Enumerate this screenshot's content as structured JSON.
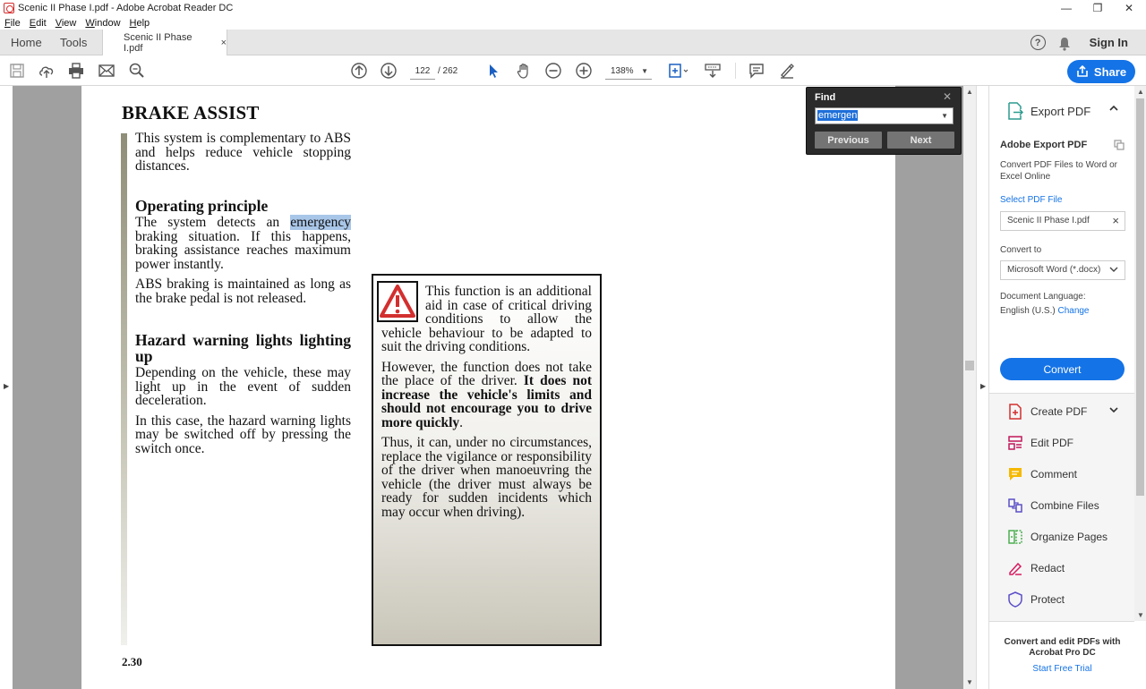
{
  "window": {
    "title": "Scenic II Phase I.pdf - Adobe Acrobat Reader DC",
    "controls": {
      "minimize": "—",
      "restore": "❐",
      "close": "✕"
    }
  },
  "menu": [
    "File",
    "Edit",
    "View",
    "Window",
    "Help"
  ],
  "tabs": {
    "home": "Home",
    "tools": "Tools",
    "document": "Scenic II Phase I.pdf",
    "close": "×",
    "sign_in": "Sign In",
    "help": "?"
  },
  "toolbar": {
    "page_current": "122",
    "page_total": "/ 262",
    "zoom": "138%",
    "share": "Share",
    "icons": [
      "save-icon",
      "upload-icon",
      "print-icon",
      "email-icon",
      "search-icon",
      "page-up-icon",
      "page-down-icon",
      "select-cursor-icon",
      "hand-icon",
      "zoom-out-icon",
      "zoom-in-icon",
      "page-fit-icon",
      "scroll-mode-icon",
      "comment-icon",
      "highlight-pen-icon"
    ]
  },
  "find": {
    "label": "Find",
    "close": "✕",
    "query": "emergen",
    "previous": "Previous",
    "next": "Next"
  },
  "document": {
    "title": "BRAKE ASSIST",
    "intro": "This system is complementary to ABS and helps reduce vehicle stopping distances.",
    "heading_operating": "Operating principle",
    "op_p1_before": "The system detects an ",
    "op_p1_highlight": "emergency",
    "op_p1_after": " braking situation. If this happens, braking assistance reaches maximum power instantly.",
    "op_p2": "ABS braking is maintained as long as the brake pedal is not released.",
    "heading_hazard": "Hazard warning lights lighting up",
    "hazard_p1": "Depending on the vehicle, these may light up in the event of sudden deceleration.",
    "hazard_p2": "In this case, the hazard warning lights may be switched off by pressing the switch once.",
    "warn_p1": "This function is an additional aid in case of critical driving conditions to allow the vehicle behaviour to be adapted to suit the driving conditions.",
    "warn_p2_normal": "However, the function does not take the place of the driver. ",
    "warn_p2_bold": "It does not increase the vehicle's limits and should not encourage you to drive more quickly",
    "warn_p2_end": ".",
    "warn_p3": "Thus, it can, under no circumstances, replace the vigilance or responsibility of the driver when manoeuvring the vehicle (the driver must always be ready for sudden incidents which may occur when driving).",
    "page_label": "2.30"
  },
  "right_panel": {
    "export_title": "Export PDF",
    "card_title": "Adobe Export PDF",
    "card_desc": "Convert PDF Files to Word or Excel Online",
    "select_file": "Select PDF File",
    "file_name": "Scenic II Phase I.pdf",
    "convert_to": "Convert to",
    "format": "Microsoft Word (*.docx)",
    "doc_language": "Document Language:",
    "language": "English (U.S.)",
    "change": "Change",
    "convert_button": "Convert",
    "tools": [
      "Create PDF",
      "Edit PDF",
      "Comment",
      "Combine Files",
      "Organize Pages",
      "Redact",
      "Protect"
    ],
    "promo_title": "Convert and edit PDFs with Acrobat Pro DC",
    "promo_link": "Start Free Trial"
  },
  "colors": {
    "accent": "#1473e6",
    "highlight": "#a8c6e8",
    "warning_red": "#d32f2f"
  }
}
